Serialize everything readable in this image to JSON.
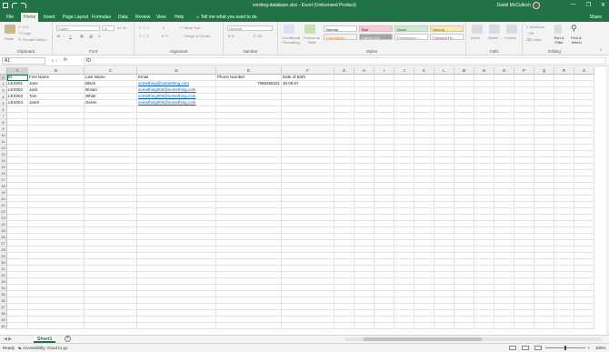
{
  "window": {
    "title": "existing-database.xlsx  -  Excel (Unlicensed Product)",
    "user": "David McCulloch",
    "minimize": "—",
    "maximize": "❐",
    "close": "✕"
  },
  "tabs": [
    "File",
    "Home",
    "Insert",
    "Page Layout",
    "Formulas",
    "Data",
    "Review",
    "View",
    "Help"
  ],
  "tell_me": "Tell me what you want to do",
  "share": "Share",
  "ribbon": {
    "clipboard": {
      "label": "Clipboard",
      "paste": "Paste",
      "cut": "Cut",
      "copy": "Copy",
      "format_painter": "Format Painter"
    },
    "font": {
      "label": "Font",
      "font_name": "Calibri",
      "font_size": "11"
    },
    "alignment": {
      "label": "Alignment",
      "wrap_text": "Wrap Text",
      "merge_center": "Merge & Center"
    },
    "number": {
      "label": "Number",
      "format": "General"
    },
    "styles": {
      "label": "Styles",
      "conditional": "Conditional Formatting",
      "format_table": "Format as Table",
      "cells": [
        "Normal",
        "Bad",
        "Good",
        "Neutral",
        "Calculation",
        "Check Cell",
        "Explanatory ...",
        "Followed Hy..."
      ]
    },
    "cells": {
      "label": "Cells",
      "insert": "Insert",
      "delete": "Delete",
      "format": "Format"
    },
    "editing": {
      "label": "Editing",
      "autosum": "AutoSum",
      "fill": "Fill",
      "clear": "Clear",
      "sort_filter": "Sort & Filter",
      "find_select": "Find & Select"
    }
  },
  "formula_bar": {
    "name_box": "A1",
    "fx": "fx",
    "value": "ID"
  },
  "columns": [
    "A",
    "B",
    "C",
    "D",
    "E",
    "F",
    "G",
    "H",
    "I",
    "J",
    "K",
    "L",
    "M",
    "N",
    "O",
    "P",
    "Q",
    "R",
    "S"
  ],
  "rows": [
    "1",
    "2",
    "3",
    "4",
    "5",
    "6",
    "7",
    "8",
    "9",
    "10",
    "11",
    "12",
    "13",
    "14",
    "15",
    "16",
    "17",
    "18",
    "19",
    "20",
    "21",
    "22",
    "23",
    "24",
    "25",
    "26",
    "27",
    "28",
    "29",
    "30",
    "31",
    "32",
    "33",
    "34",
    "35",
    "36",
    "37",
    "38",
    "39",
    "40"
  ],
  "sheet": {
    "headers": [
      "ID",
      "First Name",
      "Last Name",
      "Email",
      "Phone Number",
      "Date of Birth"
    ],
    "records": [
      [
        "LEX001",
        "Jane",
        "Black",
        "something@something.com",
        "7865256321",
        "30.09.67"
      ],
      [
        "LEX002",
        "Jack",
        "Brown",
        "something002@something.com",
        "",
        ""
      ],
      [
        "LEX003",
        "Tom",
        "White",
        "something003@something.com",
        "",
        ""
      ],
      [
        "LEX004",
        "Janet",
        "Green",
        "something004@something.com",
        "",
        ""
      ]
    ]
  },
  "sheet_tabs": {
    "active": "Sheet1",
    "add": "+"
  },
  "status": {
    "ready": "Ready",
    "accessibility": "Accessibility: Good to go",
    "zoom": "100%"
  }
}
